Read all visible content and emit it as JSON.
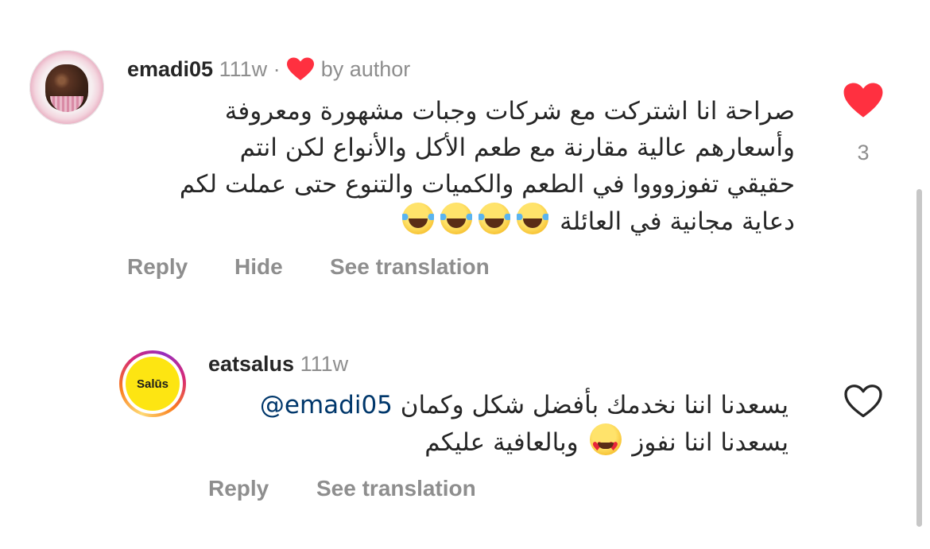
{
  "comment": {
    "username": "emadi05",
    "time": "111w",
    "separator": "·",
    "by_author": "by author",
    "text_lines": [
      "صراحة انا اشتركت مع شركات وجبات مشهورة ومعروفة",
      "وأسعارهم عالية مقارنة مع طعم الأكل والأنواع لكن انتم",
      "حقيقي تفوزوووا في الطعم والكميات والتنوع حتى عملت لكم",
      "دعاية مجانية في العائلة"
    ],
    "like_count": "3",
    "actions": {
      "reply": "Reply",
      "hide": "Hide",
      "see_translation": "See translation"
    },
    "emoji": [
      "face-with-tears-of-joy",
      "face-with-tears-of-joy",
      "face-with-tears-of-joy",
      "face-with-tears-of-joy"
    ]
  },
  "reply": {
    "username": "eatsalus",
    "time": "111w",
    "avatar_text": "Salūs",
    "mention": "@emadi05",
    "line1_text": "يسعدنا اننا نخدمك بأفضل شكل وكمان",
    "line2_before": "يسعدنا اننا نفوز",
    "line2_after": "وبالعافية عليكم",
    "emoji": "smiling-face-with-heart-eyes",
    "actions": {
      "reply": "Reply",
      "see_translation": "See translation"
    }
  },
  "colors": {
    "like_red": "#ff3040",
    "text": "#262626",
    "secondary": "#8e8e8e",
    "mention": "#00376b",
    "brand_yellow": "#fde512"
  }
}
